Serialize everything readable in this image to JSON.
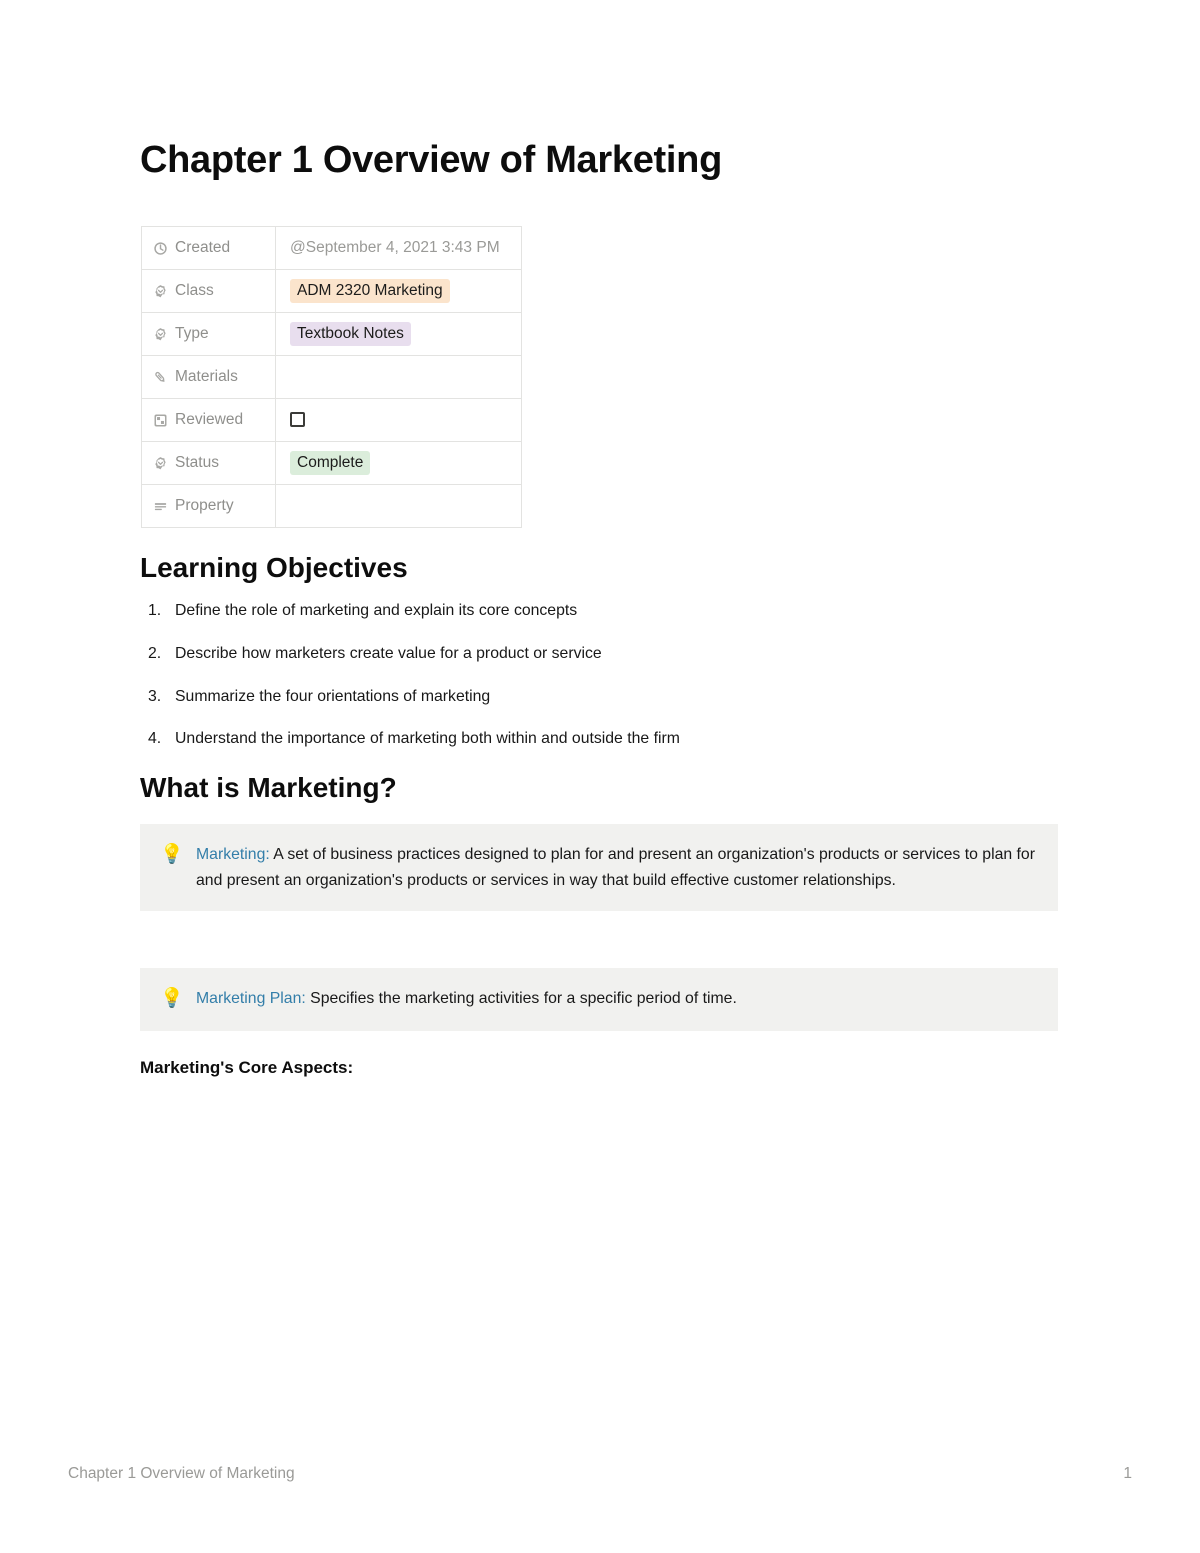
{
  "document": {
    "title": "Chapter 1 Overview of Marketing"
  },
  "properties": {
    "rows": [
      {
        "icon": "clock-icon",
        "label": "Created",
        "type": "date",
        "value": "@September 4, 2021 3:43 PM"
      },
      {
        "icon": "select-icon",
        "label": "Class",
        "type": "pill",
        "value": "ADM 2320 Marketing",
        "color": "#fbe4cc"
      },
      {
        "icon": "select-icon",
        "label": "Type",
        "type": "pill",
        "value": "Textbook Notes",
        "color": "#e8deee"
      },
      {
        "icon": "paperclip-icon",
        "label": "Materials",
        "type": "empty",
        "value": ""
      },
      {
        "icon": "checkbox-icon",
        "label": "Reviewed",
        "type": "checkbox",
        "value": "",
        "checked": false
      },
      {
        "icon": "select-icon",
        "label": "Status",
        "type": "pill",
        "value": "Complete",
        "color": "#dbeddb"
      },
      {
        "icon": "text-lines-icon",
        "label": "Property",
        "type": "empty",
        "value": ""
      }
    ]
  },
  "sections": {
    "learning_objectives": {
      "heading": "Learning Objectives",
      "items": [
        {
          "num": "1.",
          "text": "Define the role of marketing and explain its core concepts"
        },
        {
          "num": "2.",
          "text": "Describe how marketers create value for a product or service"
        },
        {
          "num": "3.",
          "text": "Summarize the four orientations of marketing"
        },
        {
          "num": "4.",
          "text": "Understand the importance of marketing both within and outside the firm"
        }
      ]
    },
    "what_is_marketing": {
      "heading": "What is Marketing?",
      "callouts": [
        {
          "emoji": "💡",
          "emoji_name": "lightbulb-icon",
          "term": "Marketing:",
          "text": " A set of business practices designed to plan for and present an organization's products or services to plan for and present an organization's products or services in way that build effective customer relationships."
        },
        {
          "emoji": "💡",
          "emoji_name": "lightbulb-icon",
          "term": "Marketing Plan:",
          "text": " Specifies the marketing activities for a specific period of time."
        }
      ],
      "lead_in": "Marketing's Core Aspects:"
    }
  },
  "footer": {
    "left": "Chapter 1 Overview of Marketing",
    "page_number": "1"
  },
  "colors": {
    "term_blue": "#337ea9",
    "callout_bg": "#f1f1ef",
    "muted_text": "#9a9a97",
    "border": "#e3e3e1"
  }
}
